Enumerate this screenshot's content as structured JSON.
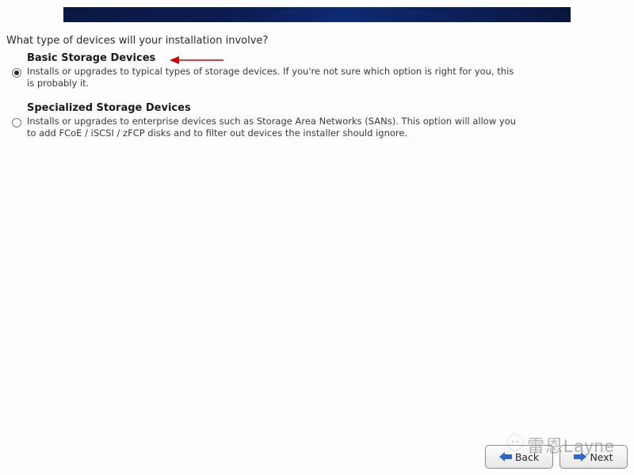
{
  "prompt": "What type of devices will your installation involve?",
  "options": [
    {
      "title": "Basic Storage Devices",
      "description": "Installs or upgrades to typical types of storage devices.  If you're not sure which option is right for you, this is probably it.",
      "selected": true
    },
    {
      "title": "Specialized Storage Devices",
      "description": "Installs or upgrades to enterprise devices such as Storage Area Networks (SANs). This option will allow you to add FCoE / iSCSI / zFCP disks and to filter out devices the installer should ignore.",
      "selected": false
    }
  ],
  "buttons": {
    "back": "Back",
    "next": "Next"
  },
  "watermark": "雷恩Layne"
}
